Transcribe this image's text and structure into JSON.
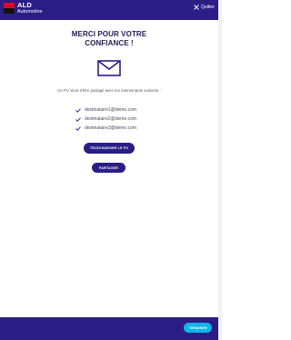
{
  "header": {
    "brand_line1": "ALD",
    "brand_line2": "Automotive",
    "quit_label": "Quitter"
  },
  "main": {
    "title_line1": "MERCI POUR VOTRE",
    "title_line2": "CONFIANCE !",
    "intro_text": "Ce PV vient d'être partagé avec les intervenants suivants :",
    "recipients": [
      "destinataire1@demo.com",
      "destinataire2@demo.com",
      "destinataire3@demo.com"
    ],
    "download_label": "TÉLÉCHARGER LE PV",
    "share_label": "PARTAGER"
  },
  "footer": {
    "finish_label": "TERMINER"
  },
  "colors": {
    "brand_navy": "#2a1e86",
    "accent_cyan": "#14b4e6",
    "logo_red": "#e60028"
  },
  "icons": {
    "mail": "envelope-icon",
    "check": "check-icon",
    "close": "close-icon"
  }
}
